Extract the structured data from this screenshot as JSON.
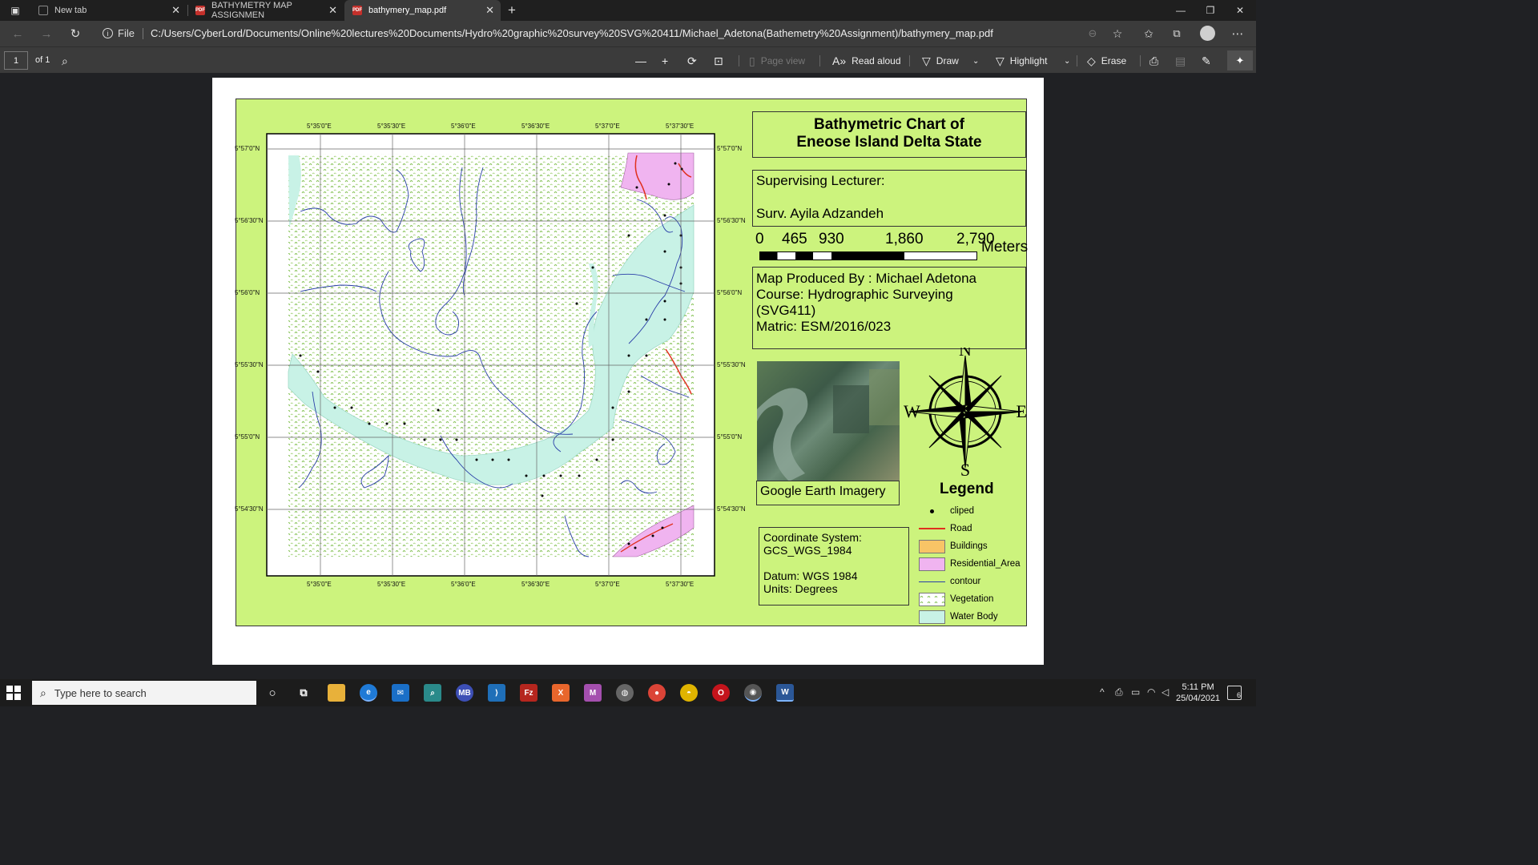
{
  "tabs": [
    {
      "label": "New tab",
      "icon": "newtab-icon"
    },
    {
      "label": "BATHYMETRY MAP ASSIGNMEN",
      "icon": "pdf-icon"
    },
    {
      "label": "bathymery_map.pdf",
      "icon": "pdf-icon"
    }
  ],
  "address": {
    "scheme_label": "File",
    "url": "C:/Users/CyberLord/Documents/Online%20lectures%20Documents/Hydro%20graphic%20survey%20SVG%20411/Michael_Adetona(Bathemetry%20Assignment)/bathymery_map.pdf"
  },
  "pdf_toolbar": {
    "page_number": "1",
    "page_count": "of 1",
    "page_view": "Page view",
    "read_aloud": "Read aloud",
    "draw": "Draw",
    "highlight": "Highlight",
    "erase": "Erase"
  },
  "map": {
    "title_line1": "Bathymetric Chart of",
    "title_line2": "Eneose Island Delta State",
    "lecturer_label": "Supervising Lecturer:",
    "lecturer_name": "Surv. Ayila Adzandeh",
    "scale": {
      "labels": [
        "0",
        "465",
        "930",
        "1,860",
        "2,790"
      ],
      "unit": "Meters"
    },
    "produced_by": "Map Produced By : Michael Adetona",
    "course_line1": "Course: Hydrographic Surveying",
    "course_line2": "(SVG411)",
    "matric": "Matric: ESM/2016/023",
    "imagery_caption": "Google Earth Imagery",
    "compass": {
      "n": "N",
      "s": "S",
      "e": "E",
      "w": "W"
    },
    "legend_title": "Legend",
    "legend": [
      {
        "label": "cliped",
        "type": "point"
      },
      {
        "label": "Road",
        "type": "line",
        "color": "#e0301e"
      },
      {
        "label": "Buildings",
        "type": "fill",
        "color": "#f8c466"
      },
      {
        "label": "Residential_Area",
        "type": "fill",
        "color": "#f0b4f0"
      },
      {
        "label": "contour",
        "type": "line",
        "color": "#2a3fa8"
      },
      {
        "label": "Vegetation",
        "type": "pattern",
        "color": "#8bc45a"
      },
      {
        "label": "Water Body",
        "type": "fill",
        "color": "#c8f2e6"
      }
    ],
    "coord_system_label": "Coordinate System:",
    "coord_system": "GCS_WGS_1984",
    "datum": "Datum: WGS 1984",
    "units": "Units: Degrees",
    "lon_ticks": [
      "5°35'0\"E",
      "5°35'30\"E",
      "5°36'0\"E",
      "5°36'30\"E",
      "5°37'0\"E",
      "5°37'30\"E"
    ],
    "lat_ticks": [
      "5°57'0\"N",
      "5°56'30\"N",
      "5°56'0\"N",
      "5°55'30\"N",
      "5°55'0\"N",
      "5°54'30\"N"
    ]
  },
  "taskbar": {
    "search_placeholder": "Type here to search",
    "time": "5:11 PM",
    "date": "25/04/2021",
    "notifications": "6"
  }
}
